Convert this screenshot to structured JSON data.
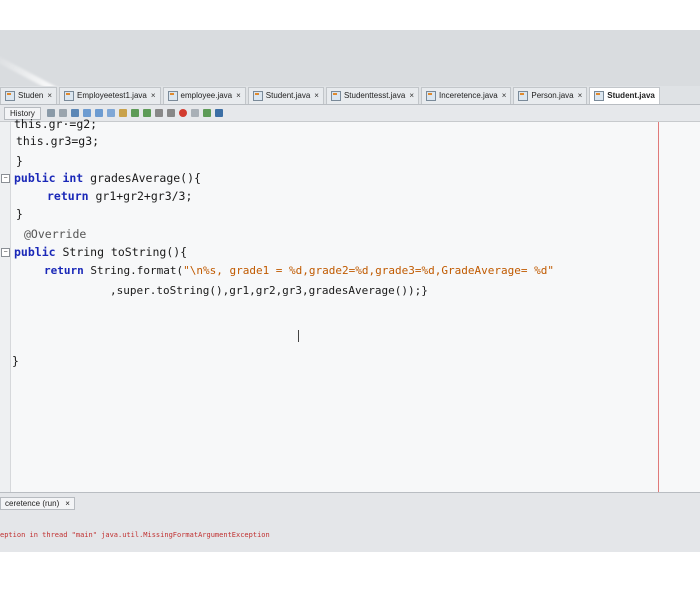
{
  "tabs": [
    {
      "label": "Studen"
    },
    {
      "label": "Employeetest1.java"
    },
    {
      "label": "employee.java"
    },
    {
      "label": "Student.java"
    },
    {
      "label": "Studenttesst.java"
    },
    {
      "label": "Inceretence.java"
    },
    {
      "label": "Person.java"
    },
    {
      "label": "Student.java",
      "active": true
    }
  ],
  "toolbar": {
    "history_label": "History"
  },
  "code_lines": {
    "l0a": "this.gr",
    "l0b": "=g2;",
    "l1": "this.gr3=g3;",
    "l2": "}",
    "l3_kw": "public int",
    "l3_rest": " gradesAverage(){",
    "l4_kw": "return",
    "l4_rest": " gr1+gr2+gr3/3;",
    "l5": "}",
    "l6": "@Override",
    "l7_kw": "public",
    "l7_rest": " String toString(){",
    "l8_kw": "return",
    "l8_mid": " String.format(",
    "l8_str": "\"\\n%s, grade1 = %d,grade2=%d,grade3=%d,GradeAverage= %d\"",
    "l9": ",super.toString(),gr1,gr2,gr3,gradesAverage());}",
    "l10": "}"
  },
  "output": {
    "tab_label": "ceretence (run)",
    "text": "eption in thread \"main\" java.util.MissingFormatArgumentException"
  },
  "colors": {
    "keyword": "#1a28b8",
    "string": "#c05a00",
    "margin": "#e07a7a"
  }
}
